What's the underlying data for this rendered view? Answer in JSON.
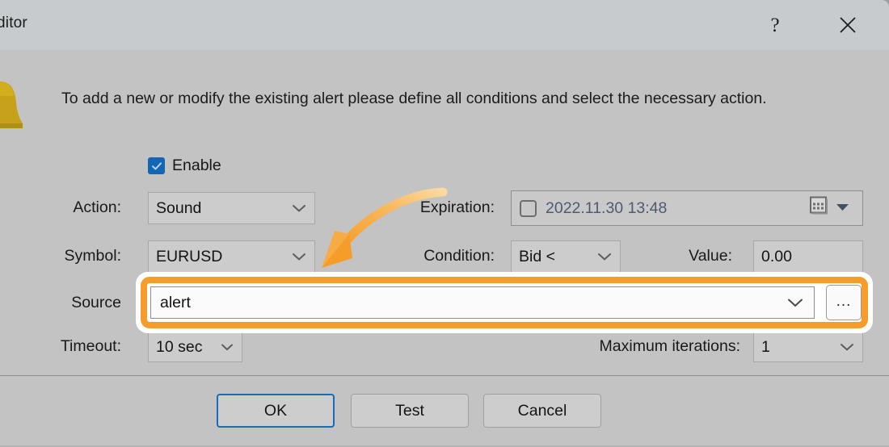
{
  "window": {
    "title": "ditor",
    "help_icon": "question-mark-icon",
    "close_icon": "close-x-icon"
  },
  "dialog": {
    "instruction": "To add a new or modify the existing alert please define all conditions and select the necessary action.",
    "bell_icon": "bell-icon",
    "enable": {
      "label": "Enable",
      "checked": true
    },
    "fields": {
      "action": {
        "label": "Action:",
        "value": "Sound"
      },
      "symbol": {
        "label": "Symbol:",
        "value": "EURUSD"
      },
      "source": {
        "label": "Source",
        "value": "alert",
        "browse_label": "..."
      },
      "timeout": {
        "label": "Timeout:",
        "value": "10 sec"
      },
      "expiration": {
        "label": "Expiration:",
        "value": "2022.11.30 13:48",
        "checked": false
      },
      "condition": {
        "label": "Condition:",
        "value": "Bid <"
      },
      "value": {
        "label": "Value:",
        "value": "0.00"
      },
      "maximum_iterations": {
        "label": "Maximum iterations:",
        "value": "1"
      }
    }
  },
  "buttons": {
    "ok": "OK",
    "test": "Test",
    "cancel": "Cancel"
  },
  "annotation": {
    "highlight_color": "#f59d28",
    "arrow_icon": "curved-arrow-icon"
  },
  "colors": {
    "dialog_background": "#c3c3c3",
    "titlebar_background": "#c8cbcd",
    "accent_blue": "#1266b4",
    "highlight_orange": "#f59d28"
  }
}
